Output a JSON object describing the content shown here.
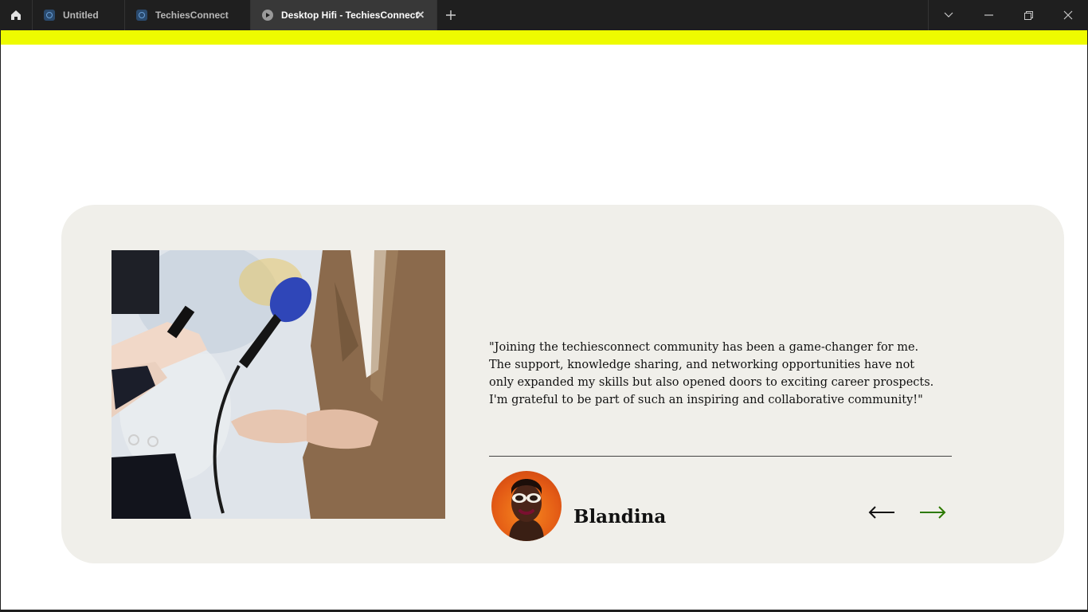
{
  "browser": {
    "tabs": [
      {
        "label": "Untitled",
        "active": false
      },
      {
        "label": "TechiesConnect",
        "active": false
      },
      {
        "label": "Desktop Hifi - TechiesConnect",
        "active": true
      }
    ],
    "icons": {
      "home": "home-icon",
      "new_tab": "plus-icon",
      "tab_list": "chevron-down-icon",
      "minimize": "minimize-icon",
      "restore": "restore-icon",
      "close": "close-icon"
    }
  },
  "colors": {
    "accent_bar": "#eefb00",
    "card_bg": "#f0efea",
    "next_arrow": "#2d7a00",
    "prev_arrow": "#111111"
  },
  "testimonial": {
    "quote": "\"Joining the techiesconnect community has been a game-changer for me. The support, knowledge sharing, and networking opportunities have not only expanded my skills but also opened doors to exciting career prospects. I'm grateful to be part of such an inspiring and collaborative community!\"",
    "name": "Blandina",
    "photo": "interview-photo",
    "avatar": "avatar-photo"
  }
}
